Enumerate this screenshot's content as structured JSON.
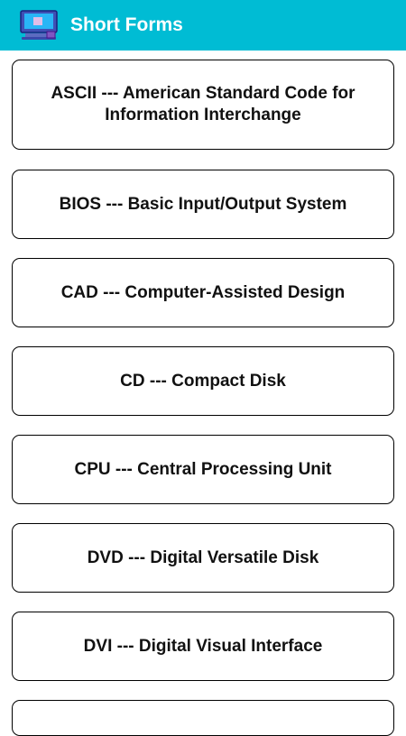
{
  "appbar": {
    "title": "Short Forms",
    "icon": "computer-icon",
    "color": "#00bcd4"
  },
  "items": [
    {
      "label": "ASCII --- American Standard Code for Information Interchange"
    },
    {
      "label": "BIOS --- Basic Input/Output System"
    },
    {
      "label": "CAD --- Computer-Assisted Design"
    },
    {
      "label": "CD --- Compact Disk"
    },
    {
      "label": "CPU --- Central Processing Unit"
    },
    {
      "label": "DVD --- Digital Versatile Disk"
    },
    {
      "label": "DVI --- Digital Visual Interface"
    },
    {
      "label": ""
    }
  ]
}
